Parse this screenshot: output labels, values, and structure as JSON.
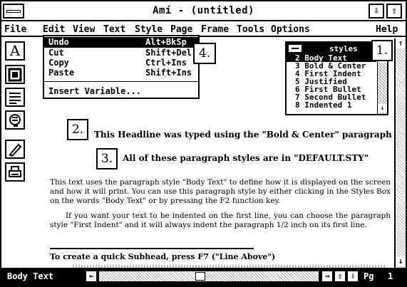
{
  "window": {
    "title": "Amí - (untitled)"
  },
  "menubar": [
    {
      "id": "file",
      "label": "File"
    },
    {
      "id": "edit",
      "label": "Edit"
    },
    {
      "id": "view",
      "label": "View"
    },
    {
      "id": "text",
      "label": "Text"
    },
    {
      "id": "style",
      "label": "Style"
    },
    {
      "id": "page",
      "label": "Page"
    },
    {
      "id": "frame",
      "label": "Frame"
    },
    {
      "id": "tools",
      "label": "Tools"
    },
    {
      "id": "options",
      "label": "Options"
    },
    {
      "id": "help",
      "label": "Help"
    }
  ],
  "edit_menu": {
    "items": [
      {
        "label": "Undo",
        "shortcut": "Alt+BkSp",
        "selected": true
      },
      {
        "label": "Cut",
        "shortcut": "Shift+Del"
      },
      {
        "label": "Copy",
        "shortcut": "Ctrl+Ins"
      },
      {
        "label": "Paste",
        "shortcut": "Shift+Ins"
      }
    ],
    "insert_variable": "Insert Variable..."
  },
  "styles_box": {
    "title": "styles",
    "items": [
      {
        "text": "2  Body Text",
        "selected": true
      },
      {
        "text": "3  Bold & Center"
      },
      {
        "text": "4  First Indent"
      },
      {
        "text": "5  Justified"
      },
      {
        "text": "6  First Bullet"
      },
      {
        "text": "7  Second Bullet"
      },
      {
        "text": "8  Indented 1"
      }
    ]
  },
  "toolbox": [
    {
      "name": "text-tool-icon",
      "glyph": "A"
    },
    {
      "name": "frame-tool-icon"
    },
    {
      "name": "paragraph-tool-icon"
    },
    {
      "name": "graphics-tool-icon"
    },
    {
      "name": "draw-tool-icon"
    },
    {
      "name": "print-tool-icon"
    }
  ],
  "document": {
    "headline": "This Headline was typed using the \"Bold & Center\" paragraph style.",
    "headline2": "All of these paragraph styles are in \"DEFAULT.STY\"",
    "para1": "This text uses the paragraph style \"Body Text\" to define how it is displayed on the screen and how it will print. You can use this paragraph style by either clicking in the Styles Box on the words \"Body Text\" or by pressing the F2 function key.",
    "para2": "If you want your text to be indented on the first line, you can choose the paragraph style \"First Indent\" and it will always indent the paragraph 1/2 inch on its first line.",
    "subhead": "To create a quick Subhead, press F7 (\"Line Above\")"
  },
  "callouts": [
    "1.",
    "2.",
    "3.",
    "4."
  ],
  "statusbar": {
    "style": "Body Text",
    "page_label": "Pg",
    "page_number": "1"
  }
}
